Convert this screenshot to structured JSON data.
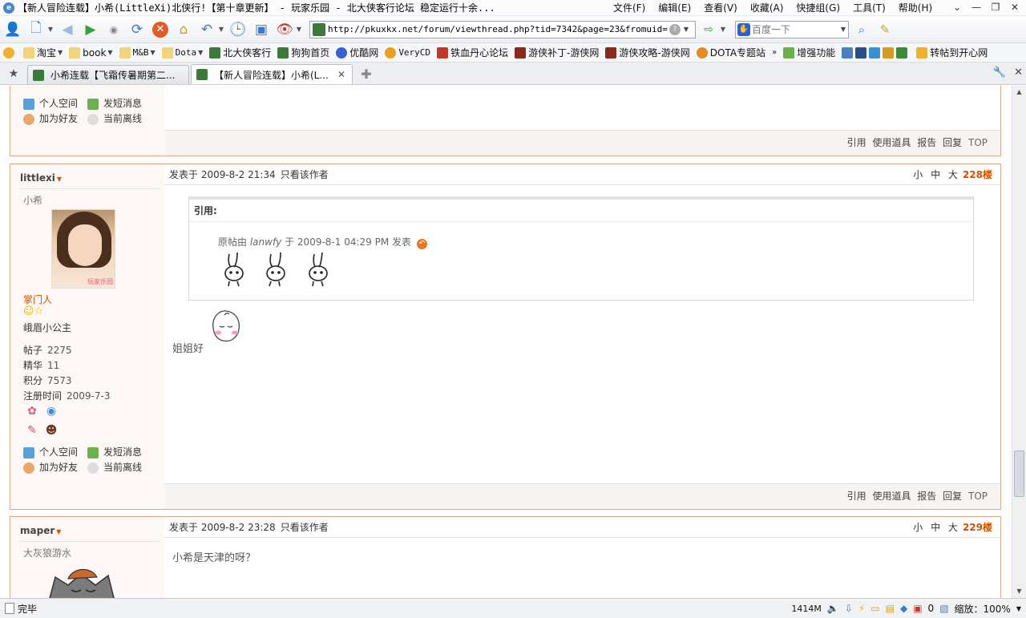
{
  "window": {
    "title": "【新人冒险连载】小希(LittleXi)北侠行!【第十章更新】 - 玩家乐园 - 北大侠客行论坛 稳定运行十余...",
    "menu": [
      "文件(F)",
      "编辑(E)",
      "查看(V)",
      "收藏(A)",
      "快捷组(G)",
      "工具(T)",
      "帮助(H)"
    ]
  },
  "toolbar": {
    "url": "http://pkuxkx.net/forum/viewthread.php?tid=7342&page=23&fromuid=4420#pi",
    "search_placeholder": "百度一下"
  },
  "favorites": [
    {
      "label": "淘宝",
      "dropdown": true
    },
    {
      "label": "book",
      "dropdown": true
    },
    {
      "label": "M&B",
      "dropdown": true
    },
    {
      "label": "Dota",
      "dropdown": true
    },
    {
      "label": "北大侠客行",
      "dropdown": false
    },
    {
      "label": "狗狗首页",
      "dropdown": false
    },
    {
      "label": "优酷网",
      "dropdown": false
    },
    {
      "label": "VeryCD",
      "dropdown": false
    },
    {
      "label": "铁血丹心论坛",
      "dropdown": false
    },
    {
      "label": "游侠补丁-游侠网",
      "dropdown": false
    },
    {
      "label": "游侠攻略-游侠网",
      "dropdown": false
    },
    {
      "label": "DOTA专题站",
      "dropdown": false
    }
  ],
  "favorites_extra": {
    "enhance": "增强功能",
    "repost": "转帖到开心网"
  },
  "tabs": [
    {
      "label": "小希连载【飞霜传暑期第二...",
      "active": false
    },
    {
      "label": "【新人冒险连载】小希(L...",
      "active": true
    }
  ],
  "top_post": {
    "links": {
      "space": "个人空间",
      "pm": "发短消息",
      "friend": "加为好友",
      "status": "当前离线"
    },
    "footer": [
      "引用",
      "使用道具",
      "报告",
      "回复",
      "TOP"
    ]
  },
  "post228": {
    "author": "littlexi",
    "user_title": "小希",
    "role": "掌门人",
    "group": "峨眉小公主",
    "stats": [
      {
        "k": "帖子",
        "v": "2275"
      },
      {
        "k": "精华",
        "v": "11"
      },
      {
        "k": "积分",
        "v": "7573"
      },
      {
        "k": "注册时间",
        "v": "2009-7-3"
      }
    ],
    "posted": "发表于 2009-8-2 21:34",
    "author_only": "只看该作者",
    "sizes": [
      "小",
      "中",
      "大"
    ],
    "floor": "228楼",
    "quote_label": "引用:",
    "quote_prefix": "原帖由",
    "quote_author": "lanwfy",
    "quote_suffix": "于 2009-8-1 04:29 PM 发表",
    "reply": "姐姐好",
    "links": {
      "space": "个人空间",
      "pm": "发短消息",
      "friend": "加为好友",
      "status": "当前离线"
    },
    "footer": [
      "引用",
      "使用道具",
      "报告",
      "回复",
      "TOP"
    ],
    "avatar_watermark": "玩家乐园"
  },
  "post229": {
    "author": "maper",
    "user_title": "大灰狼游水",
    "posted": "发表于 2009-8-2 23:28",
    "author_only": "只看该作者",
    "sizes": [
      "小",
      "中",
      "大"
    ],
    "floor": "229楼",
    "reply": "小希是天津的呀？"
  },
  "statusbar": {
    "text": "完毕",
    "memory": "1414M",
    "counter": "0",
    "zoom": "缩放：100%"
  },
  "colors": {
    "floor": "#d45100",
    "post_border": "#d9a98b",
    "side_bg": "#fdf8f5"
  }
}
